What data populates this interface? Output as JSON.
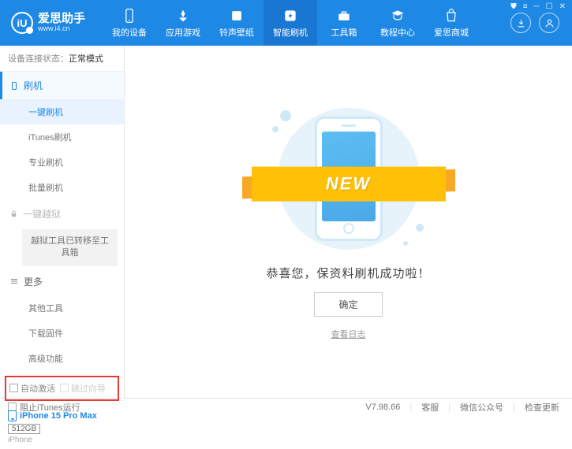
{
  "brand": {
    "title": "爱思助手",
    "url": "www.i4.cn",
    "logo_letter": "iU"
  },
  "nav": {
    "items": [
      {
        "label": "我的设备"
      },
      {
        "label": "应用游戏"
      },
      {
        "label": "铃声壁纸"
      },
      {
        "label": "智能刷机"
      },
      {
        "label": "工具箱"
      },
      {
        "label": "教程中心"
      },
      {
        "label": "爱思商城"
      }
    ]
  },
  "sidebar": {
    "status_prefix": "设备连接状态：",
    "status_value": "正常模式",
    "flash_group": "刷机",
    "flash_items": [
      "一键刷机",
      "iTunes刷机",
      "专业刷机",
      "批量刷机"
    ],
    "jailbreak_group": "一键越狱",
    "jailbreak_note": "越狱工具已转移至工具箱",
    "more_group": "更多",
    "more_items": [
      "其他工具",
      "下载固件",
      "高级功能"
    ],
    "checkbox1": "自动激活",
    "checkbox2": "跳过向导"
  },
  "device": {
    "name": "iPhone 15 Pro Max",
    "storage": "512GB",
    "type": "iPhone"
  },
  "main": {
    "ribbon": "NEW",
    "message": "恭喜您，保资料刷机成功啦！",
    "ok": "确定",
    "view_log": "查看日志"
  },
  "footer": {
    "block_itunes": "阻止iTunes运行",
    "version": "V7.98.66",
    "links": [
      "客服",
      "微信公众号",
      "检查更新"
    ]
  }
}
